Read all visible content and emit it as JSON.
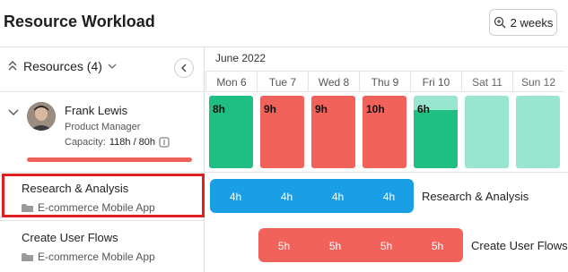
{
  "header": {
    "title": "Resource Workload",
    "zoom_label": "2 weeks"
  },
  "resources": {
    "label": "Resources (4)"
  },
  "person": {
    "name": "Frank Lewis",
    "role": "Product Manager",
    "capacity_label": "Capacity:",
    "capacity_value": "118h / 80h"
  },
  "calendar": {
    "month": "June 2022",
    "days": [
      {
        "label": "Mon 6",
        "weekend": false
      },
      {
        "label": "Tue 7",
        "weekend": false
      },
      {
        "label": "Wed 8",
        "weekend": false
      },
      {
        "label": "Thu 9",
        "weekend": false
      },
      {
        "label": "Fri 10",
        "weekend": false
      },
      {
        "label": "Sat 11",
        "weekend": true
      },
      {
        "label": "Sun 12",
        "weekend": true
      }
    ],
    "load": [
      {
        "hours": "8h",
        "status": "ok"
      },
      {
        "hours": "9h",
        "status": "over"
      },
      {
        "hours": "9h",
        "status": "over"
      },
      {
        "hours": "10h",
        "status": "over"
      },
      {
        "hours": "6h",
        "status": "under"
      },
      {
        "hours": "",
        "status": "free"
      },
      {
        "hours": "",
        "status": "free"
      }
    ]
  },
  "tasks": [
    {
      "name": "Research & Analysis",
      "project": "E-commerce Mobile App",
      "hours": [
        "4h",
        "4h",
        "4h",
        "4h"
      ],
      "color": "#1a9fe6"
    },
    {
      "name": "Create User Flows",
      "project": "E-commerce Mobile App",
      "hours": [
        "5h",
        "5h",
        "5h",
        "5h"
      ],
      "color": "#f0625a"
    }
  ],
  "colors": {
    "ok": "#1fbf83",
    "over": "#f0625a",
    "free": "#98e6cf",
    "accent": "#1a9fe6"
  }
}
